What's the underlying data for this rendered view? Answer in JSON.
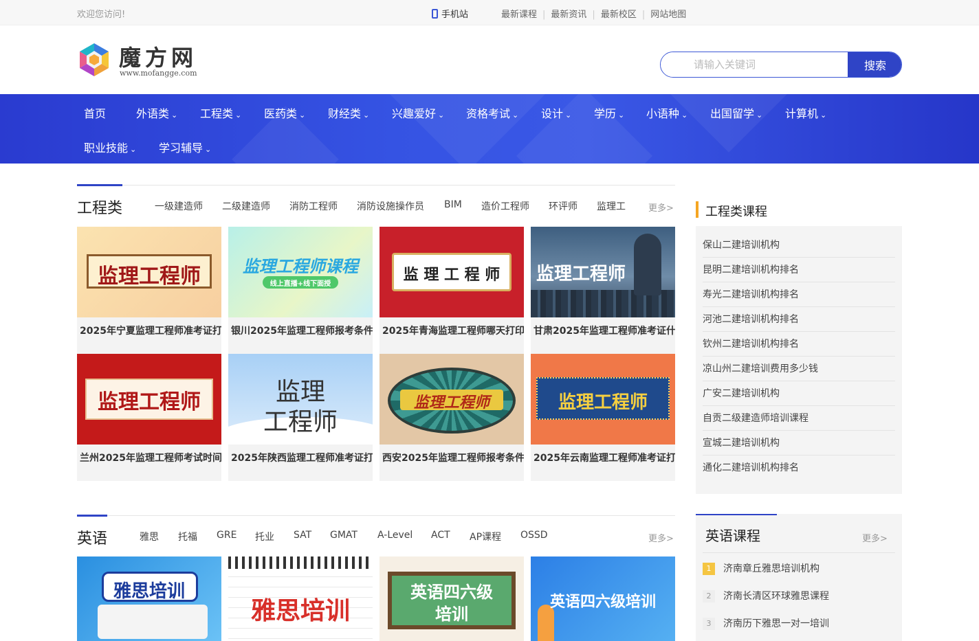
{
  "topbar": {
    "welcome": "欢迎您访问!",
    "mobile": "手机站",
    "links": [
      "最新课程",
      "最新资讯",
      "最新校区",
      "网站地图"
    ]
  },
  "logo": {
    "name": "魔方网",
    "url_text": "www.mofangge.com"
  },
  "search": {
    "placeholder": "请输入关键词",
    "button": "搜索"
  },
  "nav": {
    "row1": [
      "首页",
      "外语类",
      "工程类",
      "医药类",
      "财经类",
      "兴趣爱好",
      "资格考试",
      "设计",
      "学历",
      "小语种",
      "出国留学",
      "计算机"
    ],
    "row2": [
      "职业技能",
      "学习辅导"
    ]
  },
  "eng": {
    "title": "工程类",
    "tabs": [
      "一级建造师",
      "二级建造师",
      "消防工程师",
      "消防设施操作员",
      "BIM",
      "造价工程师",
      "环评师",
      "监理工"
    ],
    "more": "更多>",
    "cards": [
      {
        "img_text": "监理工程师",
        "caption": "2025年宁夏监理工程师准考证打"
      },
      {
        "img_text": "监理工程师课程",
        "img_sub": "线上直播+线下面授",
        "caption": "银川2025年监理工程师报考条件"
      },
      {
        "img_text": "监 理 工 程 师",
        "caption": "2025年青海监理工程师哪天打印"
      },
      {
        "img_text": "监理工程师",
        "caption": "甘肃2025年监理工程师准考证什"
      },
      {
        "img_text": "监理工程师",
        "caption": "兰州2025年监理工程师考试时间"
      },
      {
        "img_text": "监理",
        "img_text2": "工程师",
        "caption": "2025年陕西监理工程师准考证打"
      },
      {
        "img_text": "监理工程师",
        "caption": "西安2025年监理工程师报考条件"
      },
      {
        "img_text": "监理工程师",
        "caption": "2025年云南监理工程师准考证打"
      }
    ]
  },
  "eng_side": {
    "title": "工程类课程",
    "items": [
      "保山二建培训机构",
      "昆明二建培训机构排名",
      "寿光二建培训机构排名",
      "河池二建培训机构排名",
      "钦州二建培训机构排名",
      "凉山州二建培训费用多少钱",
      "广安二建培训机构",
      "自贡二级建造师培训课程",
      "宣城二建培训机构",
      "通化二建培训机构排名"
    ]
  },
  "english": {
    "title": "英语",
    "tabs": [
      "雅思",
      "托福",
      "GRE",
      "托业",
      "SAT",
      "GMAT",
      "A-Level",
      "ACT",
      "AP课程",
      "OSSD"
    ],
    "more": "更多>",
    "cards": [
      {
        "img_text": "雅思培训"
      },
      {
        "img_text": "雅思培训"
      },
      {
        "img_text": "英语四六级",
        "img_text2": "培训"
      },
      {
        "img_text": "英语四六级培训"
      }
    ]
  },
  "english_side": {
    "title": "英语课程",
    "more": "更多>",
    "items": [
      {
        "no": "1",
        "text": "济南章丘雅思培训机构"
      },
      {
        "no": "2",
        "text": "济南长清区环球雅思课程"
      },
      {
        "no": "3",
        "text": "济南历下雅思一对一培训"
      }
    ]
  },
  "colors": {
    "brand": "#2f44c6",
    "nav_bg": "#3553e3",
    "rank_highlight": "#f5c542"
  }
}
